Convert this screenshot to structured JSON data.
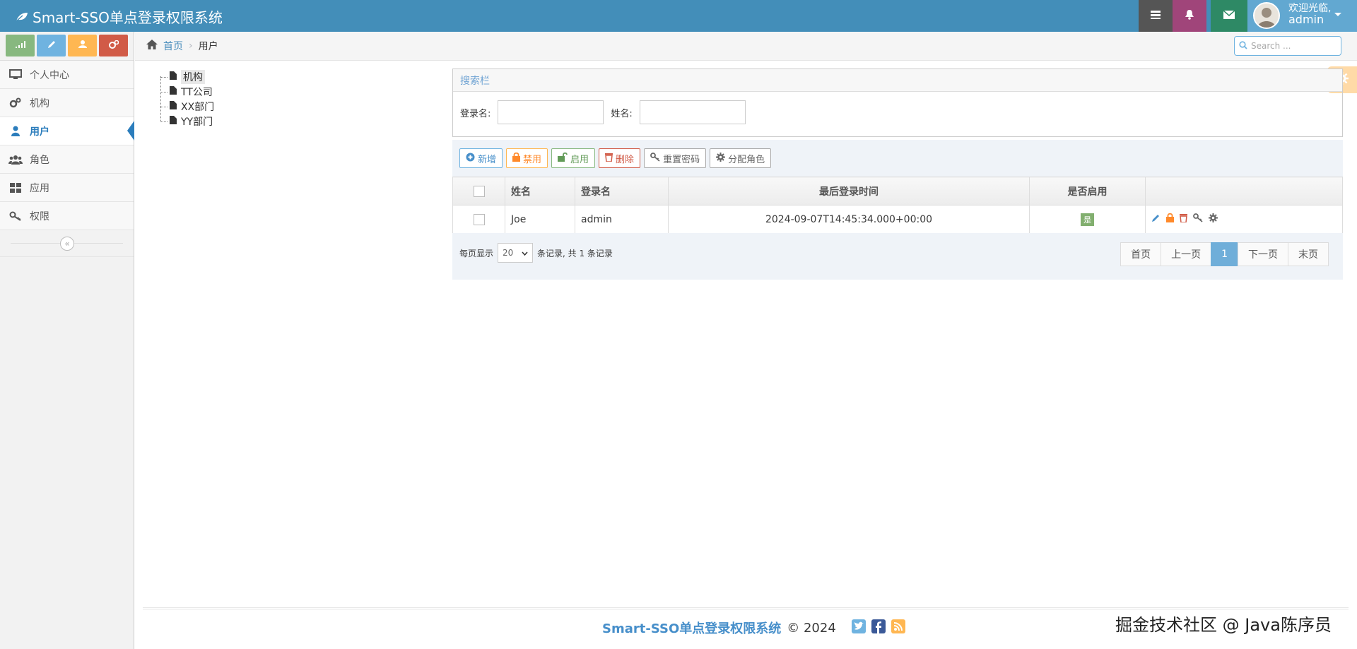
{
  "navbar": {
    "brand": "Smart-SSO单点登录权限系统",
    "welcome": "欢迎光临,",
    "username": "admin",
    "colors": {
      "tasks": "#555555",
      "notify": "#a0457a",
      "mail": "#2e8965"
    }
  },
  "shortcuts": [
    {
      "icon": "signal-icon",
      "color": "#87b87f"
    },
    {
      "icon": "pencil-icon",
      "color": "#6fb3e0"
    },
    {
      "icon": "users-icon",
      "color": "#ffb752"
    },
    {
      "icon": "cogs-icon",
      "color": "#d15b47"
    }
  ],
  "menu": [
    {
      "label": "个人中心",
      "icon": "desktop-icon"
    },
    {
      "label": "机构",
      "icon": "cogs-icon"
    },
    {
      "label": "用户",
      "icon": "user-icon",
      "active": true
    },
    {
      "label": "角色",
      "icon": "users-icon"
    },
    {
      "label": "应用",
      "icon": "grid-icon"
    },
    {
      "label": "权限",
      "icon": "key-icon"
    }
  ],
  "breadcrumb": {
    "home": "首页",
    "current": "用户"
  },
  "search": {
    "placeholder": "Search ..."
  },
  "tree": {
    "root": "机构",
    "children": [
      "TT公司",
      "XX部门",
      "YY部门"
    ]
  },
  "search_panel": {
    "title": "搜索栏",
    "login_label": "登录名:",
    "name_label": "姓名:"
  },
  "toolbar": {
    "add": "新增",
    "disable": "禁用",
    "enable": "启用",
    "delete": "删除",
    "reset": "重置密码",
    "assign": "分配角色"
  },
  "table": {
    "headers": {
      "name": "姓名",
      "login": "登录名",
      "last_login": "最后登录时间",
      "enabled": "是否启用"
    },
    "rows": [
      {
        "name": "Joe",
        "login": "admin",
        "last_login": "2024-09-07T14:45:34.000+00:00",
        "enabled": "是"
      }
    ]
  },
  "pager": {
    "per_page_label": "每页显示",
    "page_size": "20",
    "records_text": "条记录,  共 1 条记录",
    "first": "首页",
    "prev": "上一页",
    "current": "1",
    "next": "下一页",
    "last": "末页"
  },
  "footer": {
    "brand": "Smart-SSO单点登录权限系统",
    "copyright": "© 2024"
  },
  "watermark": "掘金技术社区 @ Java陈序员"
}
